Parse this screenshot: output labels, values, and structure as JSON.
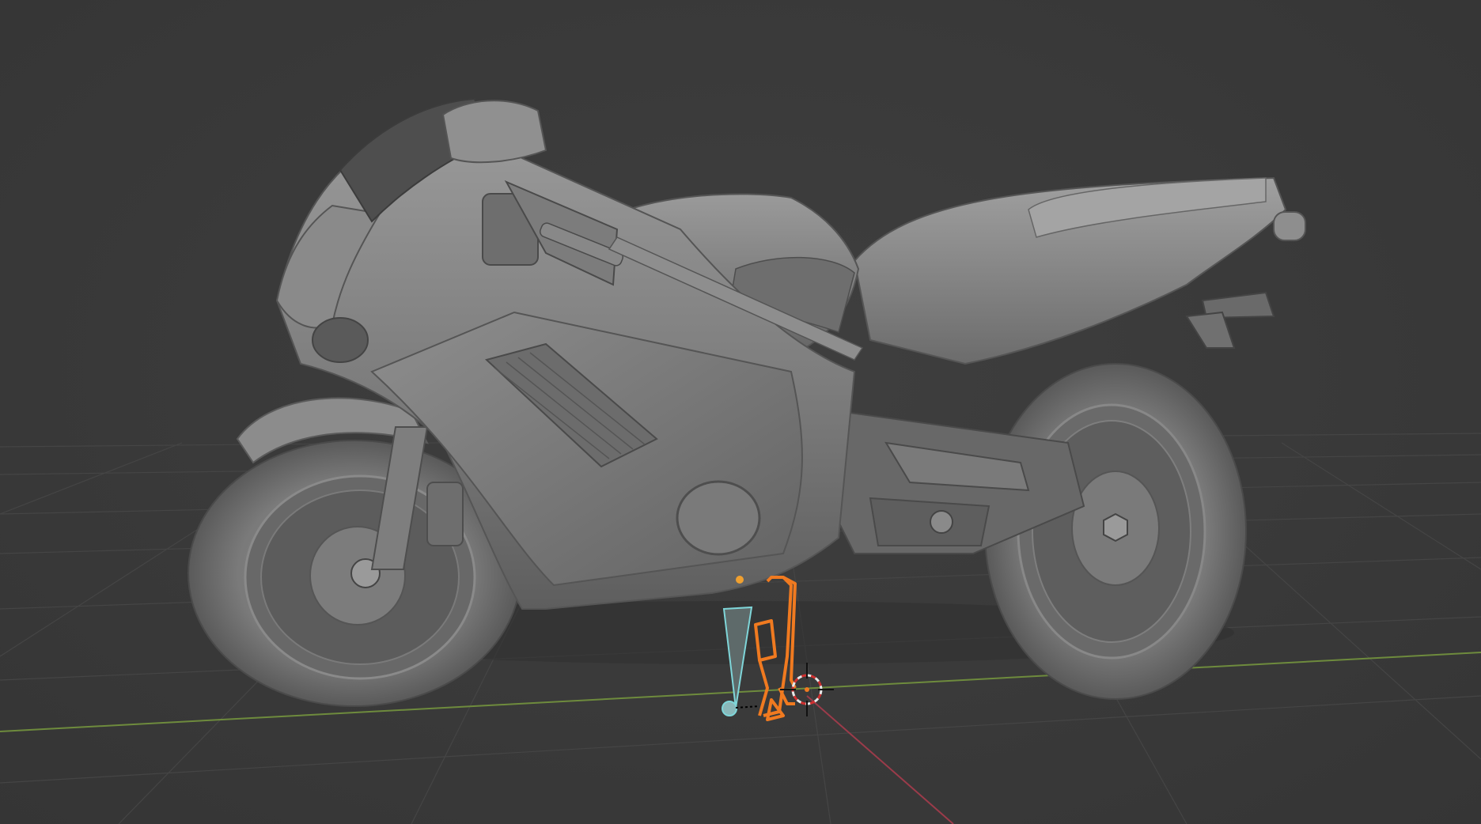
{
  "app": {
    "type": "3d-viewport",
    "background_color": "#3b3b3b"
  },
  "viewport": {
    "grid": "on",
    "axis_x_color": "#9b3b4a",
    "axis_y_color": "#6e8b3d",
    "object": "motorcycle-model",
    "object_shading": "solid",
    "selected_object": "kickstand",
    "selection_color": "#f07a20",
    "camera_color": "#7fd6d9",
    "origin_color": "#f0a030"
  },
  "icons": {
    "cursor": "3d-cursor-icon",
    "camera": "camera-icon",
    "origin": "origin-dot-icon"
  }
}
